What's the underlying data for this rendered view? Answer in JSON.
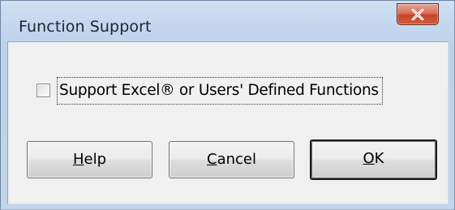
{
  "window": {
    "title": "Function Support",
    "close_icon": "close-icon"
  },
  "option": {
    "label_pre": "Support Excel",
    "label_reg": "®",
    "label_post": " or Users' Defined Functions",
    "checked": false
  },
  "buttons": {
    "help": {
      "accel": "H",
      "rest": "elp"
    },
    "cancel": {
      "accel": "C",
      "rest": "ancel"
    },
    "ok": {
      "accel": "O",
      "rest": "K"
    }
  },
  "colors": {
    "title_gradient_top": "#cfe0f2",
    "client_bg": "#f0f0f0",
    "close_red": "#c5442a"
  }
}
